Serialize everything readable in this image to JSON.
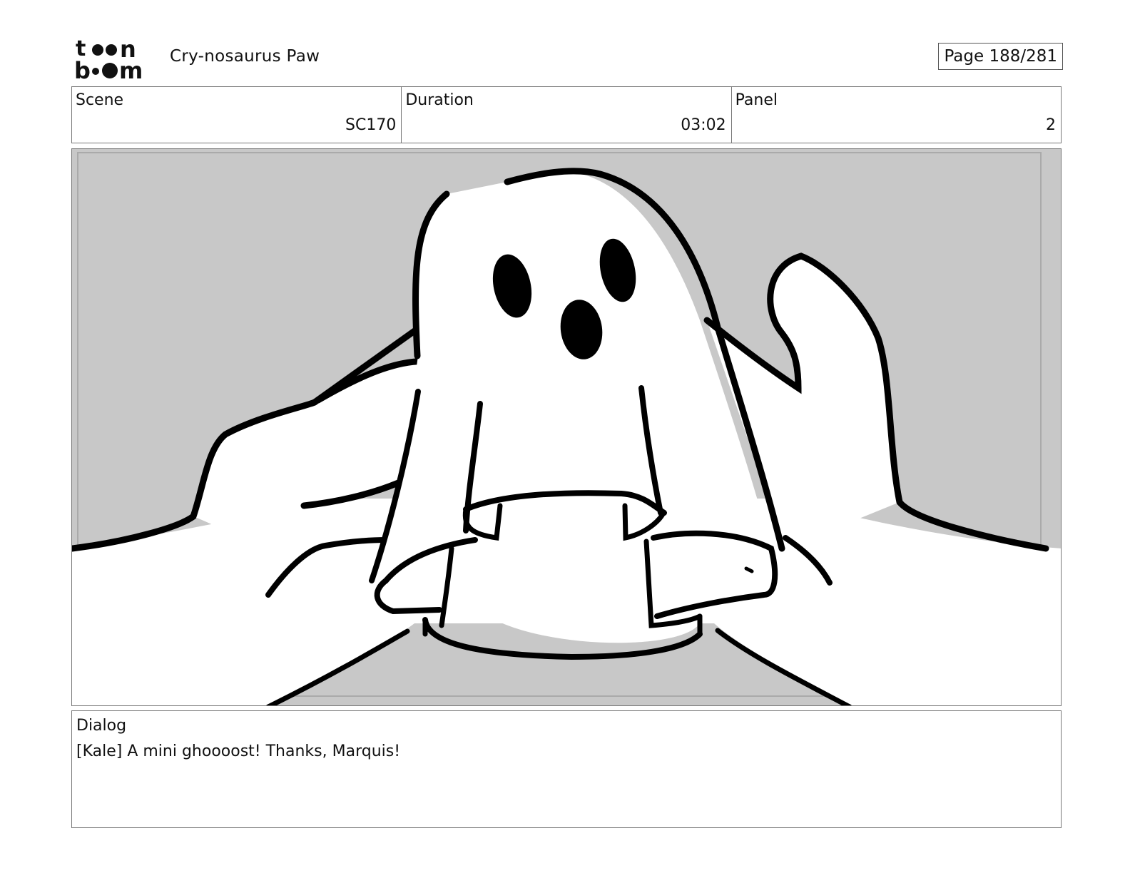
{
  "header": {
    "logo_alt": "toonboom",
    "project_title": "Cry-nosaurus Paw",
    "page_indicator": "Page 188/281"
  },
  "info": {
    "scene_label": "Scene",
    "scene_value": "SC170",
    "duration_label": "Duration",
    "duration_value": "03:02",
    "panel_label": "Panel",
    "panel_value": "2"
  },
  "dialog": {
    "label": "Dialog",
    "text": "[Kale] A mini ghoooost! Thanks, Marquis!"
  },
  "colors": {
    "background_gray": "#c8c8c8",
    "ink": "#000000",
    "paper": "#ffffff"
  }
}
